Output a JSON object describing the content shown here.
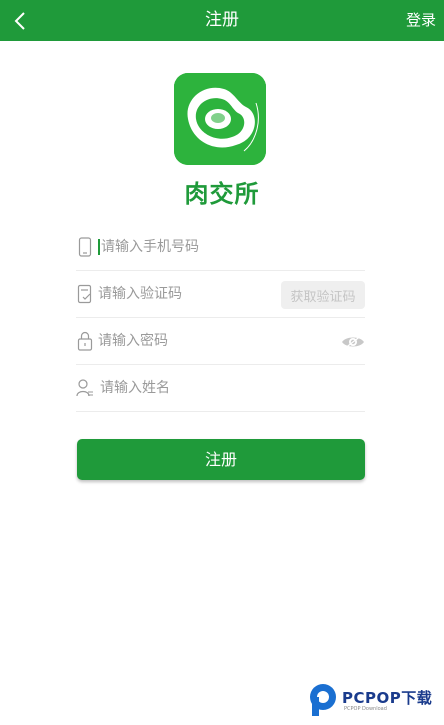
{
  "header": {
    "title": "注册",
    "login_label": "登录",
    "back_icon": "chevron-left-icon"
  },
  "app": {
    "name": "肉交所",
    "logo_icon": "meat-steak-logo"
  },
  "form": {
    "phone": {
      "placeholder": "请输入手机号码",
      "icon": "phone-icon"
    },
    "code": {
      "placeholder": "请输入验证码",
      "icon": "document-check-icon",
      "get_code_label": "获取验证码"
    },
    "password": {
      "placeholder": "请输入密码",
      "icon": "lock-icon",
      "toggle_icon": "eye-icon"
    },
    "name": {
      "placeholder": "请输入姓名",
      "icon": "user-icon"
    },
    "submit_label": "注册"
  },
  "watermark": {
    "text": "PCPOP下载",
    "subtext": "PCPOP Download"
  },
  "colors": {
    "primary": "#1f9a3a",
    "logo_bg": "#2db33d",
    "placeholder": "#9a9a9a",
    "divider": "#ececec"
  }
}
